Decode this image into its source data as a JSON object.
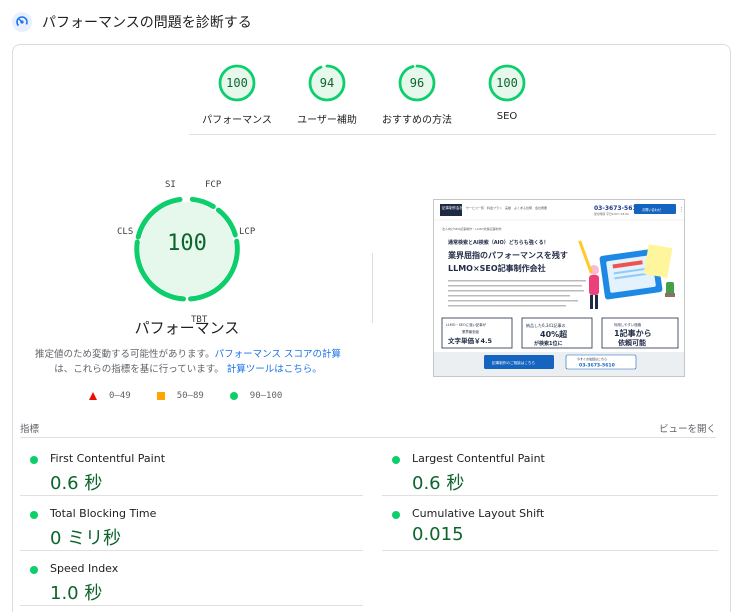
{
  "header": {
    "title": "パフォーマンスの問題を診断する",
    "icon": "speed-gauge-icon"
  },
  "summary_gauges": [
    {
      "score": "100",
      "label": "パフォーマンス",
      "fraction": 1.0
    },
    {
      "score": "94",
      "label": "ユーザー補助",
      "fraction": 0.94
    },
    {
      "score": "96",
      "label": "おすすめの方法",
      "fraction": 0.96
    },
    {
      "score": "100",
      "label": "SEO",
      "fraction": 1.0
    }
  ],
  "performance": {
    "score": "100",
    "title": "パフォーマンス",
    "segment_labels": {
      "si": "SI",
      "fcp": "FCP",
      "lcp": "LCP",
      "tbt": "TBT",
      "cls": "CLS"
    },
    "note_text_1": "推定値のため変動する可能性があります。",
    "note_link_1": "パフォーマンス スコアの計算",
    "note_text_2": "は、これらの指標を基に行っています。",
    "note_link_2": "計算ツールはこちら。"
  },
  "legend": {
    "fail": "0–49",
    "average": "50–89",
    "pass": "90–100"
  },
  "colors": {
    "pass": "#0cce6b",
    "pass_text": "#0d652d",
    "average": "#ffa400",
    "fail": "#eb0f00",
    "link": "#1a73e8"
  },
  "metrics_section": {
    "heading": "指標",
    "expand_label": "ビューを開く",
    "items": [
      {
        "name": "First Contentful Paint",
        "value": "0.6 秒"
      },
      {
        "name": "Largest Contentful Paint",
        "value": "0.6 秒"
      },
      {
        "name": "Total Blocking Time",
        "value": "0 ミリ秒"
      },
      {
        "name": "Cumulative Layout Shift",
        "value": "0.015"
      },
      {
        "name": "Speed Index",
        "value": "1.0 秒"
      }
    ]
  },
  "screenshot": {
    "logo": "記事制作会社",
    "nav_text": "サービス一覧　料金プラン　実績　よくある質問　会社概要",
    "phone": "03-3673-5610",
    "hours": "受付時間 平日9:00〜18:00",
    "cta_top": "お問い合わせ",
    "breadcrumb": "法人向けSEO記事制作・LLMO対策記事制作",
    "subhead": "通常検索とAI検索（AIO）どちらも強くる！",
    "headline_1": "業界屈指のパフォーマンスを残す",
    "headline_2": "LLMO×SEO記事制作会社",
    "body_text": "記事制作のプロフェッショナルチームが、SEOとLLMOの両面からお客様のメディア成長を支援します。",
    "box1_title": "LLMO・SEOに強い記事が",
    "box1_sub": "業界最安級",
    "box1_val": "文字単価￥4.5",
    "box2_title": "納品した6,341記事の",
    "box2_val": "40%超",
    "box2_sub": "が検索1位に",
    "box3_title": "利用しやすい価格",
    "box3_val1": "1記事から",
    "box3_val2": "依頼可能",
    "cta1": "記事制作のご相談はこちら",
    "cta2_title": "今すぐお電話はこちら",
    "cta2_phone": "03-3673-5610"
  }
}
